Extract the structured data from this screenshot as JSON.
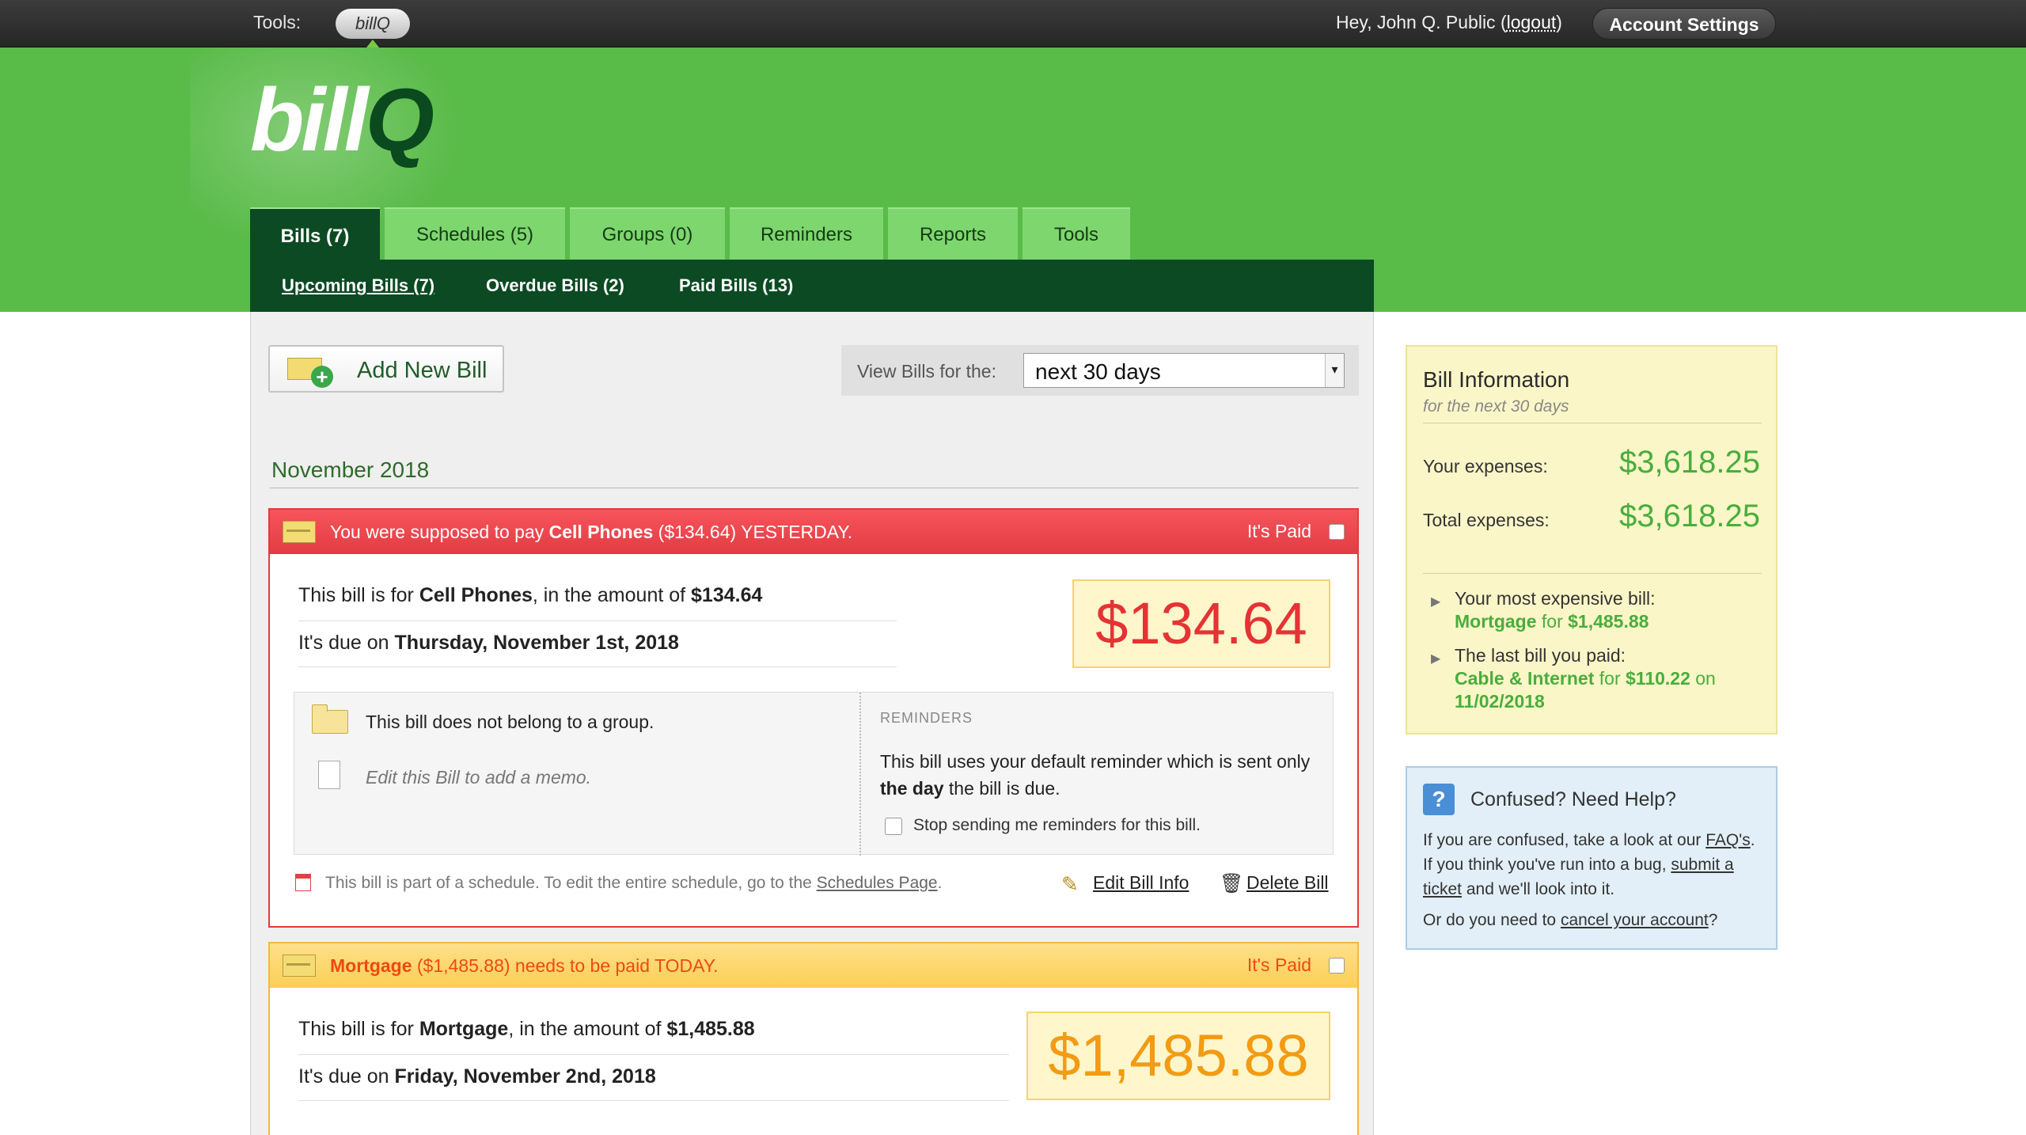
{
  "topbar": {
    "tools_label": "Tools:",
    "active_tool": "billQ",
    "greeting_prefix": "Hey, John Q. Public (",
    "logout": "logout",
    "greeting_suffix": ")",
    "account_settings": "Account Settings"
  },
  "logo": {
    "part1": "bill",
    "part2": "Q"
  },
  "tabs": [
    "Bills (7)",
    "Schedules (5)",
    "Groups (0)",
    "Reminders",
    "Reports",
    "Tools"
  ],
  "subnav": [
    "Upcoming Bills (7)",
    "Overdue Bills (2)",
    "Paid Bills (13)"
  ],
  "toolbar": {
    "add_bill": "Add New Bill",
    "view_label": "View Bills for the:",
    "view_value": "next 30 days"
  },
  "month": "November 2018",
  "bills": [
    {
      "head_pre": "You were supposed to pay ",
      "head_name": "Cell Phones",
      "head_post": " ($134.64) YESTERDAY.",
      "paid_label": "It's Paid",
      "line1_pre": "This bill is for ",
      "name": "Cell Phones",
      "line1_mid": ", in the amount of ",
      "amount": "$134.64",
      "line2_pre": "It's due on ",
      "due": "Thursday, November 1st, 2018",
      "big_amount": "$134.64",
      "group_text": "This bill does not belong to a group.",
      "memo_text": "Edit this Bill to add a memo.",
      "reminders_head": "REMINDERS",
      "reminder_pre": "This bill uses your default reminder which is sent only ",
      "reminder_bold": "the day",
      "reminder_post": " the bill is due.",
      "stop_reminders": "Stop sending me reminders for this bill.",
      "schedule_pre": "This bill is part of a schedule. To edit the entire schedule, go to the ",
      "schedule_link": "Schedules Page",
      "schedule_post": ".",
      "edit": "Edit Bill Info",
      "delete": "Delete Bill"
    },
    {
      "head_name": "Mortgage",
      "head_post": " ($1,485.88) needs to be paid TODAY.",
      "paid_label": "It's Paid",
      "line1_pre": "This bill is for ",
      "name": "Mortgage",
      "line1_mid": ", in the amount of ",
      "amount": "$1,485.88",
      "line2_pre": "It's due on ",
      "due": "Friday, November 2nd, 2018",
      "big_amount": "$1,485.88"
    }
  ],
  "info_panel": {
    "title": "Bill Information",
    "subtitle": "for the next 30 days",
    "your_label": "Your expenses:",
    "your_value": "$3,618.25",
    "total_label": "Total expenses:",
    "total_value": "$3,618.25",
    "most_label": "Your most expensive bill:",
    "most_name": "Mortgage",
    "most_mid": " for ",
    "most_amount": "$1,485.88",
    "last_label": "The last bill you paid:",
    "last_name": "Cable & Internet",
    "last_mid": " for ",
    "last_amount": "$110.22",
    "last_on": " on ",
    "last_date": "11/02/2018"
  },
  "help_panel": {
    "icon": "?",
    "title": "Confused? Need Help?",
    "t1": "If you are confused, take a look at our ",
    "faq": "FAQ's",
    "t2": ". If you think you've run into a bug, ",
    "ticket": "submit a ticket",
    "t3": " and we'll look into it.",
    "t4": "Or do you need to ",
    "cancel": "cancel your account",
    "t5": "?"
  },
  "colors": {
    "brand_green": "#59bb48",
    "dark_green": "#0b4a22",
    "overdue_red": "#e43a3a",
    "due_today_orange": "#f7b73b"
  }
}
